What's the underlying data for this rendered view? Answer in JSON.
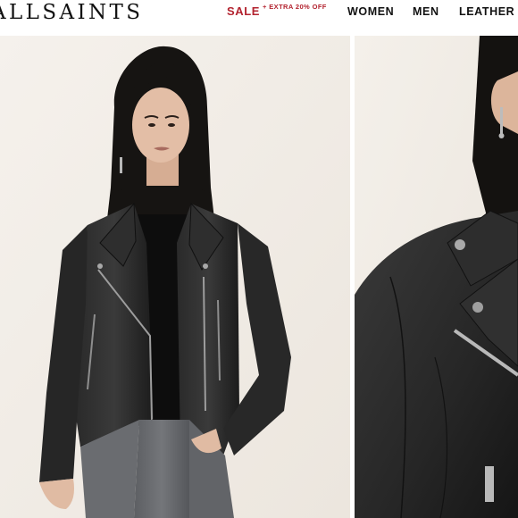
{
  "header": {
    "logo": "ALLSAINTS",
    "sale_label": "SALE",
    "sale_promo": "+ EXTRA 20% OFF",
    "nav": {
      "women": "WOMEN",
      "men": "MEN",
      "leather": "LEATHER"
    }
  },
  "colors": {
    "sale": "#b3232f",
    "backdrop": "#f3efe9",
    "jacket": "#1f1f1f"
  },
  "gallery": {
    "images": [
      {
        "name": "product-photo-full",
        "subject": "black leather biker jacket on model"
      },
      {
        "name": "product-photo-detail",
        "subject": "collar and zip close-up"
      }
    ]
  }
}
